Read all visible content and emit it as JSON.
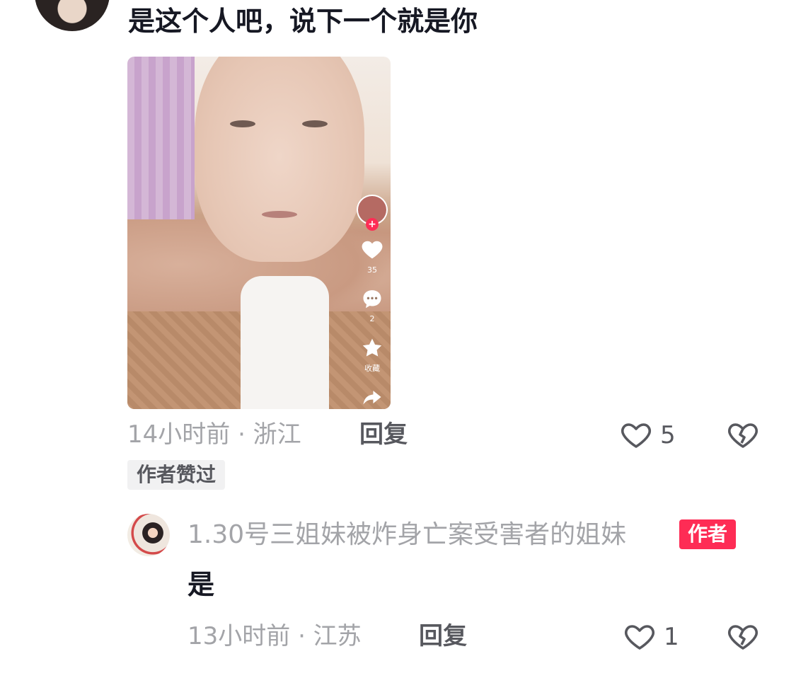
{
  "comment": {
    "text": "是这个人吧，说下一个就是你",
    "time_location": "14小时前 · 浙江",
    "reply_label": "回复",
    "like_count": "5",
    "author_liked_badge": "作者赞过"
  },
  "video_preview": {
    "like_count": "35",
    "comment_count": "2",
    "favorite_label": "收藏"
  },
  "reply": {
    "username": "1.30号三姐妹被炸身亡案受害者的姐妹",
    "author_tag": "作者",
    "text": "是",
    "time_location": "13小时前 · 江苏",
    "reply_label": "回复",
    "like_count": "1"
  },
  "colors": {
    "accent": "#fe2c55",
    "meta_text": "#a3a4a8",
    "primary_text": "#161823"
  }
}
